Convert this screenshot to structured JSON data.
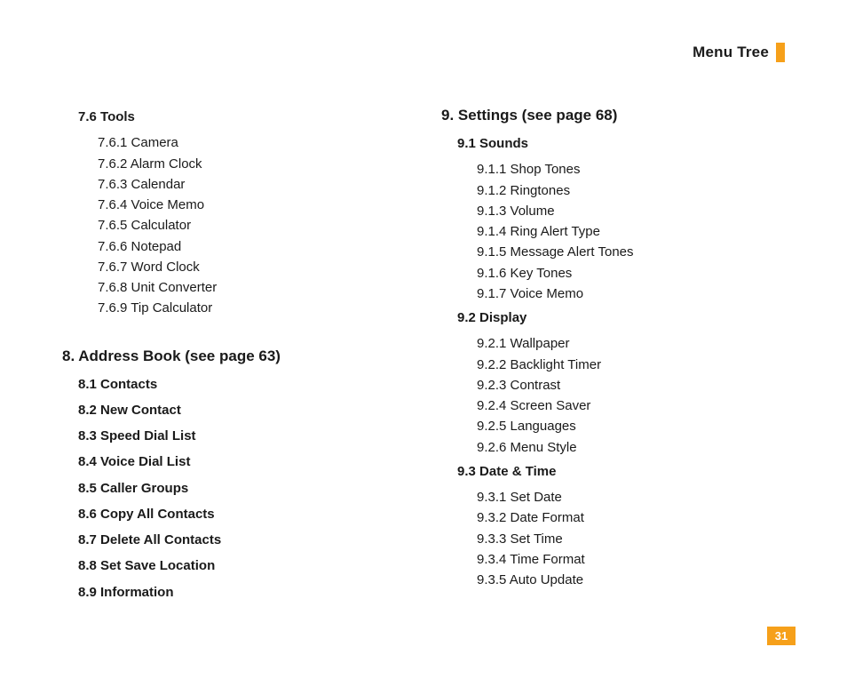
{
  "header": {
    "title": "Menu Tree"
  },
  "page_number": "31",
  "left_column": {
    "section_76": {
      "heading": "7.6 Tools",
      "items": [
        "7.6.1 Camera",
        "7.6.2 Alarm Clock",
        "7.6.3 Calendar",
        "7.6.4 Voice Memo",
        "7.6.5 Calculator",
        "7.6.6 Notepad",
        "7.6.7 Word Clock",
        "7.6.8 Unit Converter",
        "7.6.9 Tip Calculator"
      ]
    },
    "section_8": {
      "heading": "8.  Address Book (see page 63)",
      "items": [
        "8.1 Contacts",
        "8.2 New Contact",
        "8.3 Speed Dial List",
        "8.4 Voice Dial List",
        "8.5 Caller Groups",
        "8.6 Copy All Contacts",
        "8.7 Delete All Contacts",
        "8.8 Set Save Location",
        "8.9 Information"
      ]
    }
  },
  "right_column": {
    "section_9": {
      "heading": "9.  Settings (see page 68)",
      "sub_91": {
        "heading": "9.1 Sounds",
        "items": [
          "9.1.1 Shop Tones",
          "9.1.2 Ringtones",
          "9.1.3 Volume",
          "9.1.4 Ring Alert Type",
          "9.1.5 Message Alert Tones",
          "9.1.6 Key Tones",
          "9.1.7 Voice Memo"
        ]
      },
      "sub_92": {
        "heading": "9.2 Display",
        "items": [
          "9.2.1 Wallpaper",
          "9.2.2 Backlight Timer",
          "9.2.3 Contrast",
          "9.2.4 Screen Saver",
          "9.2.5 Languages",
          "9.2.6 Menu Style"
        ]
      },
      "sub_93": {
        "heading": "9.3 Date & Time",
        "items": [
          "9.3.1 Set Date",
          "9.3.2 Date Format",
          "9.3.3 Set Time",
          "9.3.4 Time Format",
          "9.3.5 Auto Update"
        ]
      }
    }
  }
}
